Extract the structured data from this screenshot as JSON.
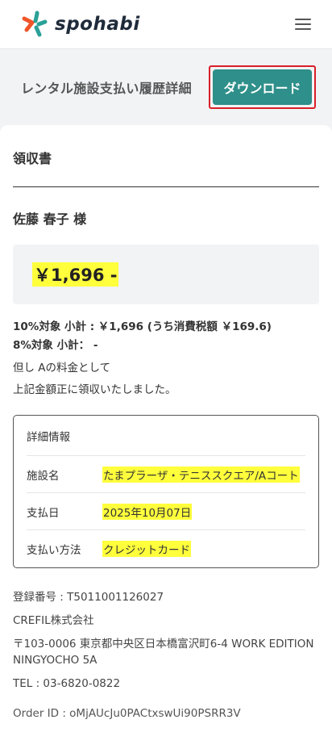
{
  "header": {
    "logo_text": "spohabi",
    "logo_icon": "spohabi-logo-icon",
    "menu_icon": "hamburger-menu-icon",
    "colors": {
      "logo_orange": "#f0552a",
      "logo_teal": "#2aa198",
      "logo_dark": "#1f2b3a"
    }
  },
  "title_bar": {
    "title": "レンタル施設支払い履歴詳細",
    "download_label": "ダウンロード",
    "download_color": "#2f8f8a",
    "highlight_border": "#d9202a"
  },
  "receipt": {
    "title": "領収書",
    "customer": "佐藤 春子 様",
    "amount": "￥1,696 -",
    "tax_10": "10%対象 小計 : ￥1,696 (うち消費税額 ￥169.6)",
    "tax_8": "8%対象 小計： -",
    "note_1": "但し Aの料金として",
    "note_2": "上記金額正に領収いたしました。"
  },
  "detail": {
    "heading": "詳細情報",
    "rows": [
      {
        "label": "施設名",
        "value": "たまプラーザ・テニススクエア/Aコート"
      },
      {
        "label": "支払日",
        "value": "2025年10月07日"
      },
      {
        "label": "支払い方法",
        "value": "クレジットカード"
      }
    ]
  },
  "company": {
    "reg_number": "登録番号 : T5011001126027",
    "name": "CREFIL株式会社",
    "address": "〒103-0006 東京都中央区日本橋富沢町6-4 WORK EDITION NINGYOCHO 5A",
    "tel": "TEL : 03-6820-0822",
    "order_id": "Order ID : oMjAUcJu0PACtxswUi90PSRR3V"
  },
  "highlight_color": "#ffff3c"
}
